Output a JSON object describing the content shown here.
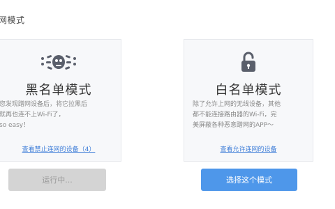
{
  "section": {
    "title": "网模式"
  },
  "blacklist": {
    "title": "黑名单模式",
    "desc": [
      "您发现蹭网设备后，将它拉黑后",
      "就再也连不上Wi-Fi了，",
      "so easy！"
    ],
    "link": "查看禁止连网的设备（4）",
    "button": "运行中..."
  },
  "whitelist": {
    "title": "白名单模式",
    "desc": [
      "除了允许上网的无线设备，其他",
      "都不能连接路由器的Wi-Fi，完",
      "美屏蔽各种恶意蹭网的APP～"
    ],
    "link": "查看允许连网的设备",
    "button": "选择这个模式"
  },
  "colors": {
    "accent": "#4e97ea",
    "link": "#3f7ed8",
    "disabled": "#d4d4d4",
    "icon": "#5a5f6b"
  },
  "icons": {
    "blacklist": "bug-block-icon",
    "whitelist": "unlock-icon"
  }
}
